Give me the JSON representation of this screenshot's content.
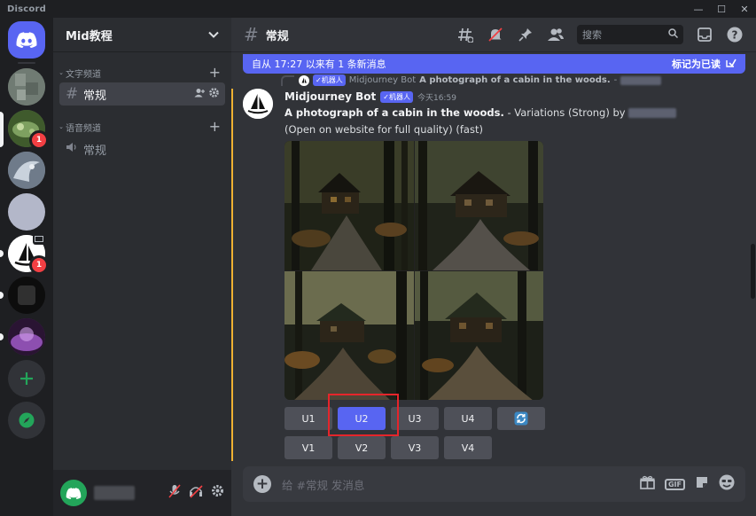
{
  "app": {
    "brand": "Discord"
  },
  "window_controls": [
    "—",
    "☐",
    "✕"
  ],
  "servers": [
    {
      "name": "server-1",
      "color": "#6e7a72"
    },
    {
      "name": "server-2",
      "color": "#5c7a4a",
      "badge": "1"
    },
    {
      "name": "server-3",
      "color": "#8a96a6"
    },
    {
      "name": "server-4",
      "color": "#b3b7c9"
    },
    {
      "name": "server-midjourney",
      "color": "#ffffff",
      "badge": "1"
    },
    {
      "name": "server-6",
      "color": "#111111"
    },
    {
      "name": "server-7",
      "color": "#5b2d6e"
    }
  ],
  "guild": {
    "name": "Mid教程"
  },
  "categories": {
    "text": "文字频道",
    "voice": "语音频道"
  },
  "channels": {
    "text_channel": "常规",
    "voice_channel": "常规"
  },
  "chat": {
    "channel_name": "常规",
    "search_placeholder": "搜索",
    "new_messages_text": "自从 17:27 以来有 1 条新消息",
    "mark_read": "标记为已读"
  },
  "reply": {
    "author": "Midjourney Bot",
    "tag": "✓机器人",
    "text": "A photograph of a cabin in the woods.",
    "suffix": " - "
  },
  "message": {
    "author": "Midjourney Bot",
    "tag": "✓机器人",
    "timestamp": "今天16:59",
    "prompt": "A photograph of a cabin in the woods.",
    "after_prompt": " - Variations (Strong) by ",
    "after_user": "(Open on website for full quality) (fast)"
  },
  "buttons": {
    "row1": [
      "U1",
      "U2",
      "U3",
      "U4"
    ],
    "row2": [
      "V1",
      "V2",
      "V3",
      "V4"
    ]
  },
  "composer": {
    "placeholder": "给 #常规 发消息"
  },
  "colors": {
    "accent": "#5865f2",
    "highlight": "#e5252b",
    "online": "#23a55a"
  }
}
